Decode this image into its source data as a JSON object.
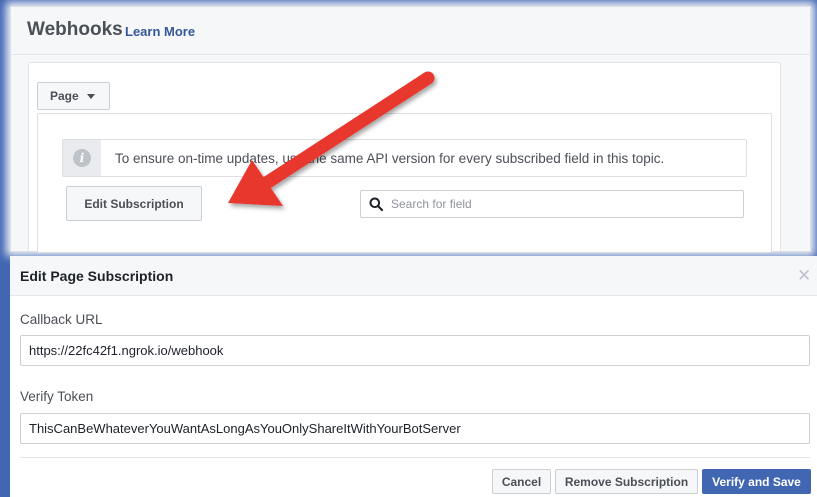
{
  "colors": {
    "brand_blue": "#4267b2",
    "link_blue": "#365899",
    "arrow_red": "#e8372f"
  },
  "webhooks": {
    "title": "Webhooks",
    "learn_more": "Learn More",
    "object_dropdown": {
      "selected": "Page",
      "icon": "caret-down-icon"
    },
    "info_notice": {
      "icon": "info-icon",
      "text": "To ensure on-time updates, use the same API version for every subscribed field in this topic."
    },
    "edit_subscription_label": "Edit Subscription",
    "search": {
      "icon": "search-icon",
      "placeholder": "Search for field",
      "value": ""
    }
  },
  "modal": {
    "title": "Edit Page Subscription",
    "close_icon": "close-icon",
    "callback_url": {
      "label": "Callback URL",
      "value": "https://22fc42f1.ngrok.io/webhook"
    },
    "verify_token": {
      "label": "Verify Token",
      "value": "ThisCanBeWhateverYouWantAsLongAsYouOnlyShareItWithYourBotServer"
    },
    "buttons": {
      "cancel": "Cancel",
      "remove": "Remove Subscription",
      "verify_save": "Verify and Save"
    }
  }
}
